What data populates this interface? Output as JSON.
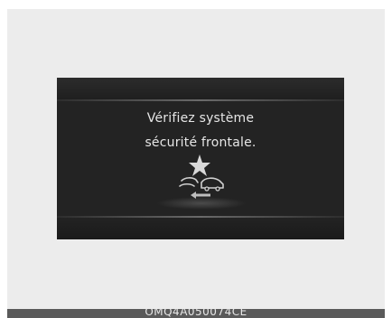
{
  "display": {
    "message_line1": "Vérifiez système",
    "message_line2": "sécurité frontale.",
    "icon": "forward-collision-warning-icon"
  },
  "caption": {
    "code": "OMQ4A050074CE"
  },
  "colors": {
    "screen_background": "#232323",
    "text": "#e6e6e6",
    "frame_background": "#ececec",
    "caption_bar": "#5a5a5a"
  }
}
